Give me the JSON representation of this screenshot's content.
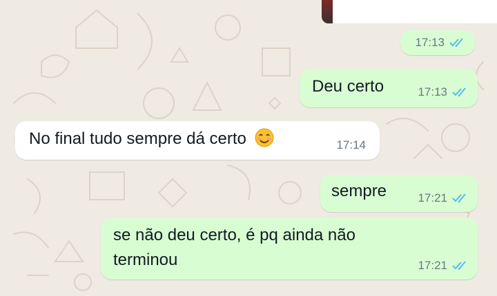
{
  "chat": {
    "colors": {
      "outgoing_bubble": "#d9fdd3",
      "incoming_bubble": "#ffffff",
      "read_tick": "#53bdeb",
      "wallpaper": "#efeae2"
    },
    "messages": [
      {
        "direction": "outgoing",
        "text": "",
        "time": "17:13",
        "status": "read-double-tick-icon"
      },
      {
        "direction": "outgoing",
        "text": "Deu certo",
        "time": "17:13",
        "status": "read-double-tick-icon"
      },
      {
        "direction": "incoming",
        "text": "No final tudo sempre dá certo",
        "emoji": "smiling-face-icon",
        "time": "17:14"
      },
      {
        "direction": "outgoing",
        "text": "sempre",
        "time": "17:21",
        "status": "read-double-tick-icon"
      },
      {
        "direction": "outgoing",
        "text_lines": [
          "se não deu certo, é pq ainda não",
          "terminou"
        ],
        "time": "17:21",
        "status": "read-double-tick-icon"
      }
    ]
  }
}
